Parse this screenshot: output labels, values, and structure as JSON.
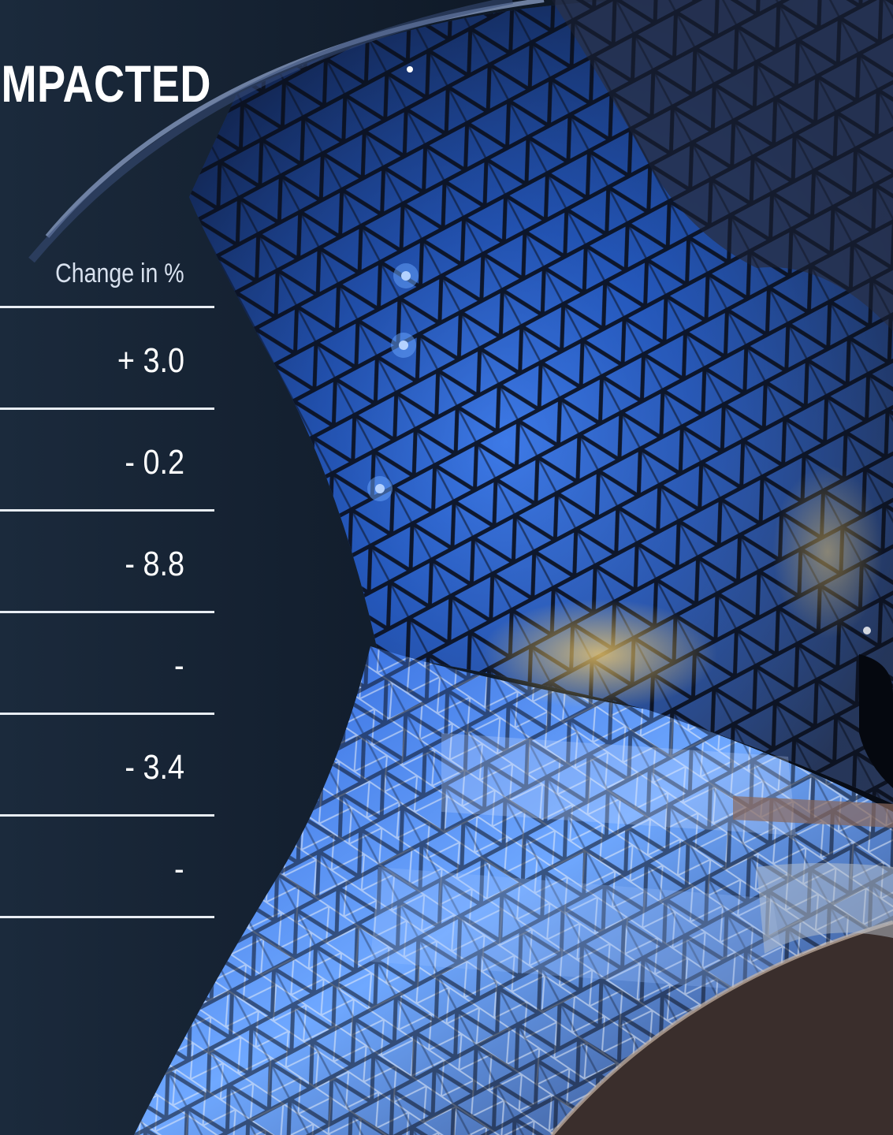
{
  "slide": {
    "title_fragment": "MPACTED",
    "column_header": "Change in %",
    "rows": [
      {
        "value": "+ 3.0"
      },
      {
        "value": "- 0.2"
      },
      {
        "value": "- 8.8"
      },
      {
        "value": "-"
      },
      {
        "value": "- 3.4"
      },
      {
        "value": "-"
      }
    ]
  },
  "colors": {
    "panel": "#0f1a2b",
    "accent_blue": "#2f78ff",
    "text": "#ffffff"
  }
}
